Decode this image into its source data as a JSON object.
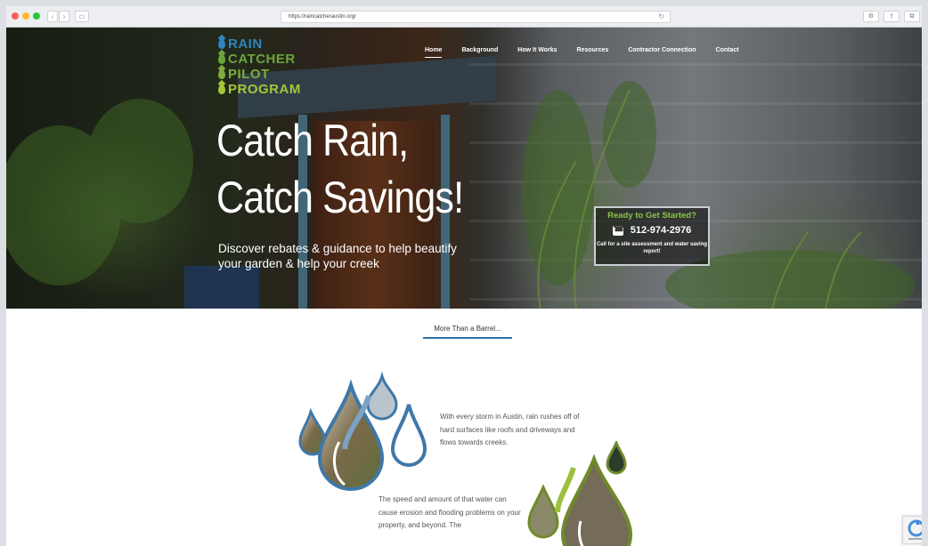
{
  "browser": {
    "url": "https://raincatcheraustin.org/",
    "back_glyph": "‹",
    "forward_glyph": "›",
    "sidebar_glyph": "▭",
    "reload_glyph": "↻",
    "right_buttons": [
      "⚙",
      "⇪",
      "⧉"
    ],
    "traffic_colors": [
      "#fc5d57",
      "#fdbc2e",
      "#28c840"
    ]
  },
  "logo": {
    "lines": [
      {
        "text": "RAIN",
        "color": "#2e86c1"
      },
      {
        "text": "CATCHER",
        "color": "#6aa63a"
      },
      {
        "text": "PILOT",
        "color": "#7fae3c"
      },
      {
        "text": "PROGRAM",
        "color": "#a4c639"
      }
    ]
  },
  "nav": {
    "items": [
      {
        "label": "Home",
        "active": true
      },
      {
        "label": "Background",
        "active": false
      },
      {
        "label": "How It Works",
        "active": false
      },
      {
        "label": "Resources",
        "active": false
      },
      {
        "label": "Contractor Connection",
        "active": false
      },
      {
        "label": "Contact",
        "active": false
      }
    ]
  },
  "hero": {
    "headline_line1": "Catch Rain,",
    "headline_line2": "Catch Savings!",
    "subline": "Discover rebates & guidance to help beautify your garden & help your creek"
  },
  "cta": {
    "title": "Ready to Get Started?",
    "phone": "512-974-2976",
    "note": "Call for a site assessment and water saving report!"
  },
  "section": {
    "tab_label": "More Than a Barrel...",
    "paragraph1": "With every storm in Austin, rain rushes off of hard surfaces like roofs and driveways and flows towards creeks.",
    "paragraph2": "The speed and amount of that water can cause erosion and flooding problems on your property, and beyond. The"
  },
  "colors": {
    "tab_underline": "#2e6fa7",
    "cta_title": "#8bc34a",
    "drop_blue_outline": "#3f78a8",
    "drop_green_outline": "#6f8a2a"
  }
}
